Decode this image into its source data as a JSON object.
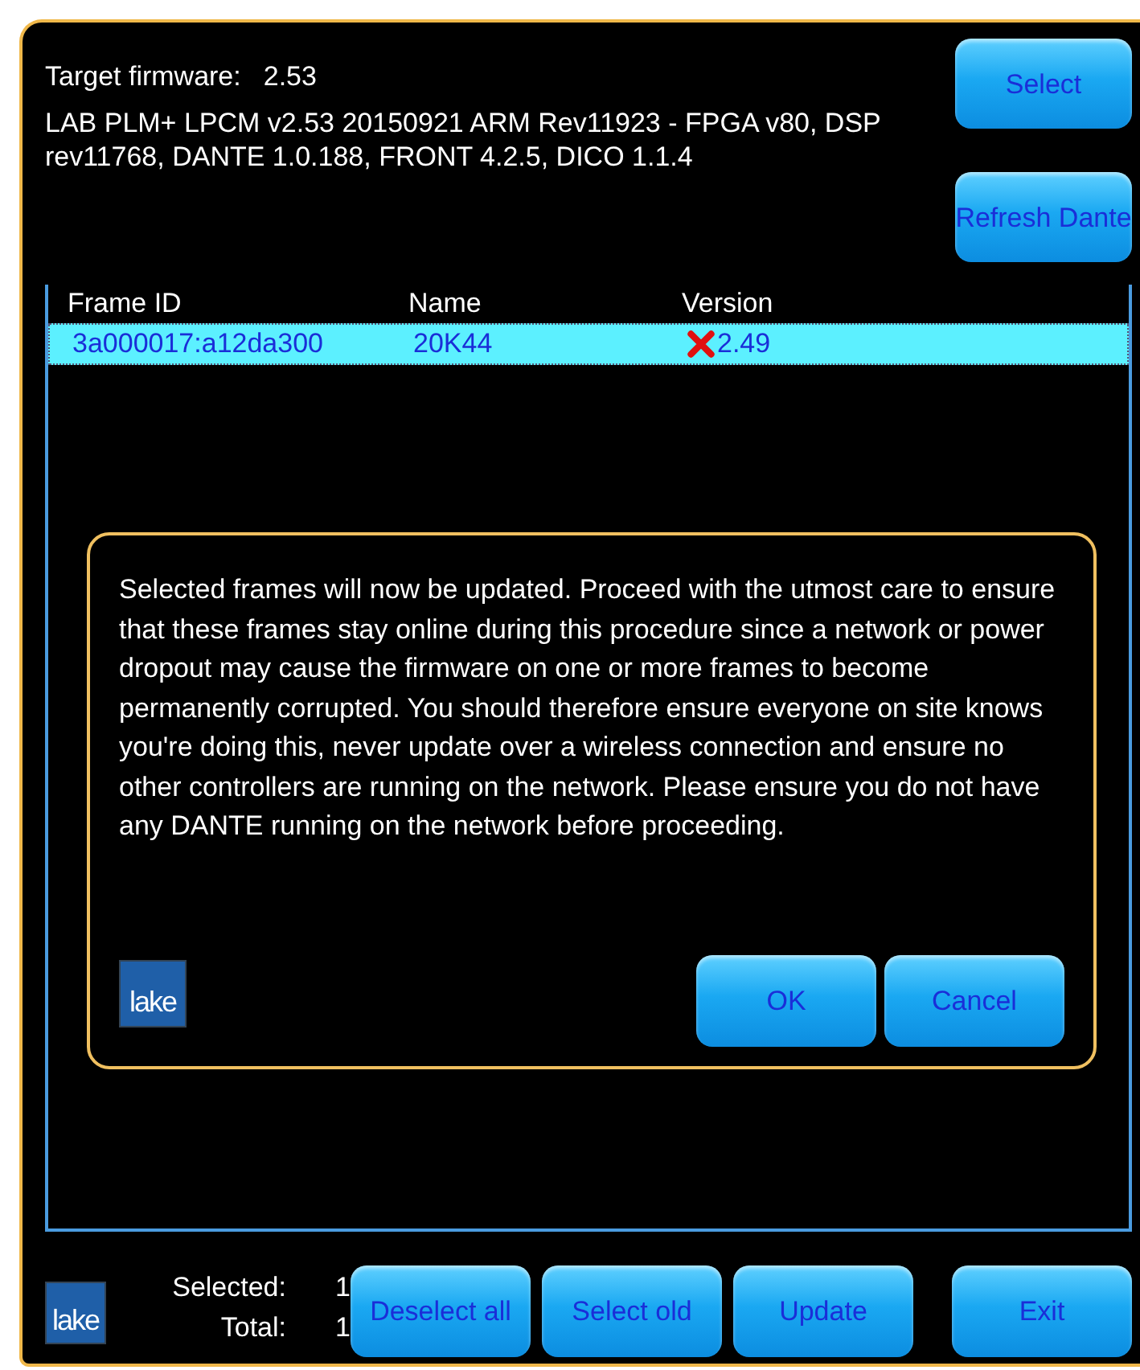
{
  "header": {
    "target_label": "Target firmware:",
    "target_value": "2.53",
    "description": "LAB PLM+ LPCM v2.53 20150921 ARM Rev11923 - FPGA v80, DSP rev11768, DANTE 1.0.188, FRONT 4.2.5, DICO 1.1.4"
  },
  "side_buttons": [
    "Select",
    "Refresh Dante"
  ],
  "table": {
    "columns": [
      "Frame ID",
      "Name",
      "Version"
    ],
    "rows": [
      {
        "frame_id": "3a000017:a12da300",
        "name": "20K44",
        "version": "2.49",
        "outdated": true,
        "selected": true
      }
    ]
  },
  "dialog": {
    "message": "Selected frames will now be updated. Proceed with the utmost care to ensure that these frames stay online during this procedure since a network or power dropout may cause the firmware on one or more frames to become permanently corrupted. You should therefore ensure everyone on site knows you're doing this, never update over a wireless connection and ensure no other controllers are running on the network. Please ensure you do not have any DANTE running on the network before proceeding.",
    "logo": "lake",
    "buttons": [
      "OK",
      "Cancel"
    ]
  },
  "footer": {
    "logo": "lake",
    "stats": [
      {
        "label": "Selected:",
        "value": "1"
      },
      {
        "label": "Total:",
        "value": "1"
      }
    ],
    "buttons": [
      "Deselect all",
      "Select old",
      "Update",
      "Exit"
    ]
  }
}
